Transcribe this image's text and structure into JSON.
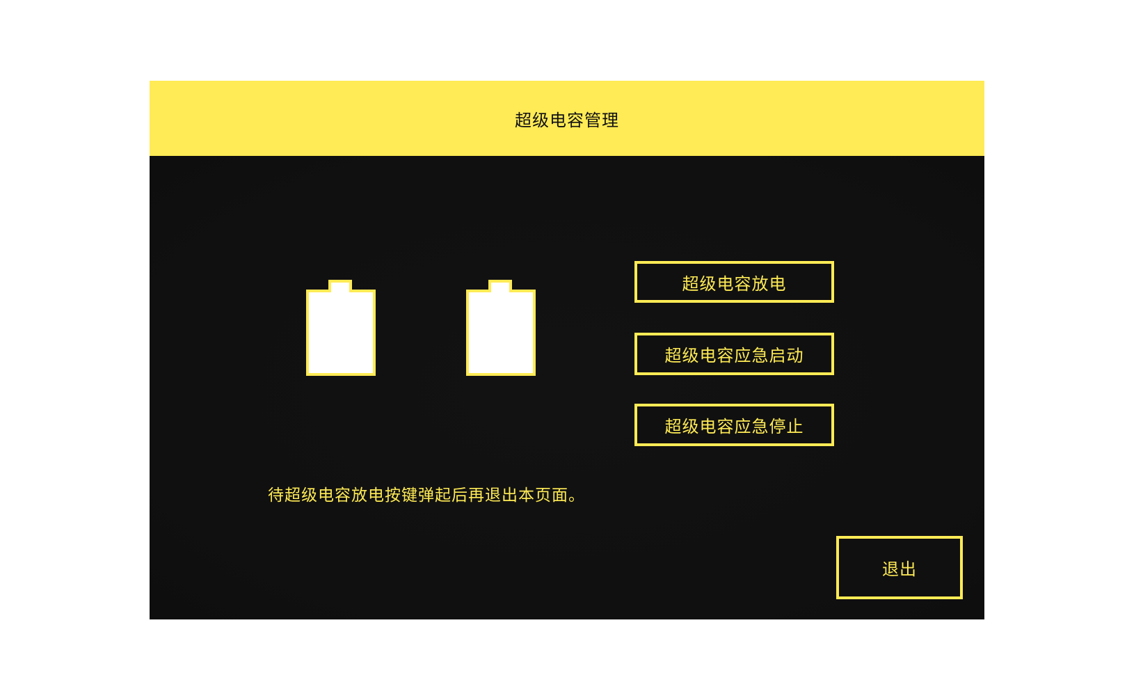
{
  "header": {
    "title": "超级电容管理"
  },
  "batteries": [
    {
      "name": "battery-1"
    },
    {
      "name": "battery-2"
    }
  ],
  "actions": {
    "discharge_label": "超级电容放电",
    "emergency_start_label": "超级电容应急启动",
    "emergency_stop_label": "超级电容应急停止"
  },
  "notice": "待超级电容放电按键弹起后再退出本页面。",
  "exit_label": "退出",
  "colors": {
    "accent": "#ffeb55",
    "panel_bg": "#101010",
    "battery_fill": "#ffffff"
  },
  "icons": [
    "battery-icon"
  ]
}
